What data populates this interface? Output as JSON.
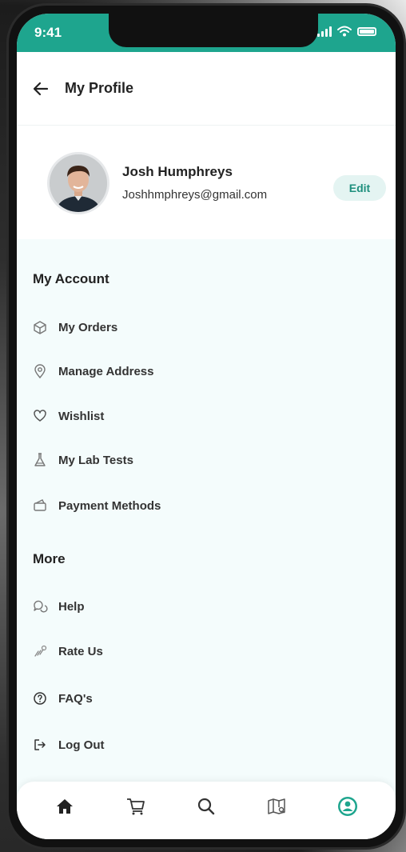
{
  "status_bar": {
    "time": "9:41"
  },
  "header": {
    "title": "My Profile"
  },
  "profile": {
    "name": "Josh Humphreys",
    "email": "Joshhmphreys@gmail.com",
    "edit_label": "Edit"
  },
  "sections": {
    "account_title": "My Account",
    "account_items": [
      {
        "label": "My Orders",
        "icon": "box-icon"
      },
      {
        "label": "Manage Address",
        "icon": "location-pin-icon"
      },
      {
        "label": "Wishlist",
        "icon": "heart-icon"
      },
      {
        "label": "My Lab Tests",
        "icon": "flask-icon"
      },
      {
        "label": "Payment Methods",
        "icon": "wallet-icon"
      }
    ],
    "more_title": "More",
    "more_items": [
      {
        "label": "Help",
        "icon": "chat-help-icon"
      },
      {
        "label": "Rate Us",
        "icon": "stars-icon"
      },
      {
        "label": "FAQ's",
        "icon": "question-circle-icon"
      },
      {
        "label": "Log Out",
        "icon": "logout-icon"
      }
    ]
  },
  "tabbar": {
    "tabs": [
      "home-icon",
      "cart-icon",
      "search-icon",
      "map-icon",
      "profile-icon"
    ],
    "active_tab": "profile-icon"
  },
  "colors": {
    "accent": "#1ea58e",
    "edit_bg": "#e4f4f2",
    "content_bg": "#f4fcfc"
  }
}
